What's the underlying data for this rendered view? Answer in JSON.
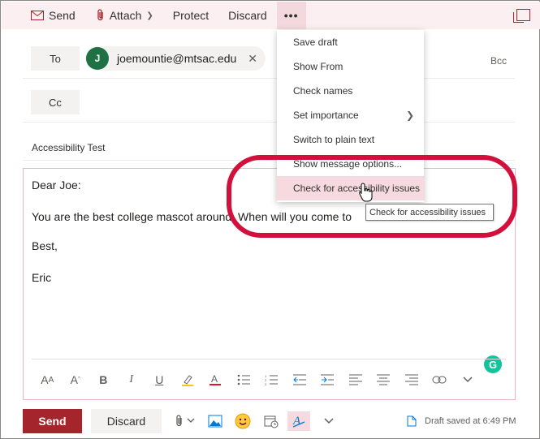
{
  "toolbar": {
    "send": "Send",
    "attach": "Attach",
    "protect": "Protect",
    "discard": "Discard",
    "more": "•••"
  },
  "recipients": {
    "to_label": "To",
    "cc_label": "Cc",
    "bcc_label": "Bcc",
    "to_avatar_initial": "J",
    "to_email": "joemountie@mtsac.edu"
  },
  "subject": "Accessibility Test",
  "body": {
    "lines": [
      "Dear Joe:",
      "You are the best college mascot around. When will you come to",
      "Best,",
      "Eric"
    ]
  },
  "more_menu": {
    "items": [
      {
        "label": "Save draft"
      },
      {
        "label": "Show From"
      },
      {
        "label": "Check names"
      },
      {
        "label": "Set importance"
      },
      {
        "label": "Switch to plain text"
      },
      {
        "label": "Show message options..."
      },
      {
        "label": "Check for accessibility issues"
      }
    ]
  },
  "tooltip": "Check for accessibility issues",
  "footer": {
    "send": "Send",
    "discard": "Discard",
    "draft_status": "Draft saved at 6:49 PM"
  },
  "colors": {
    "accent": "#a4262c",
    "toolbar_bg": "#fbeff1",
    "annotation_ring": "#d1103b",
    "avatar": "#1e7145"
  }
}
